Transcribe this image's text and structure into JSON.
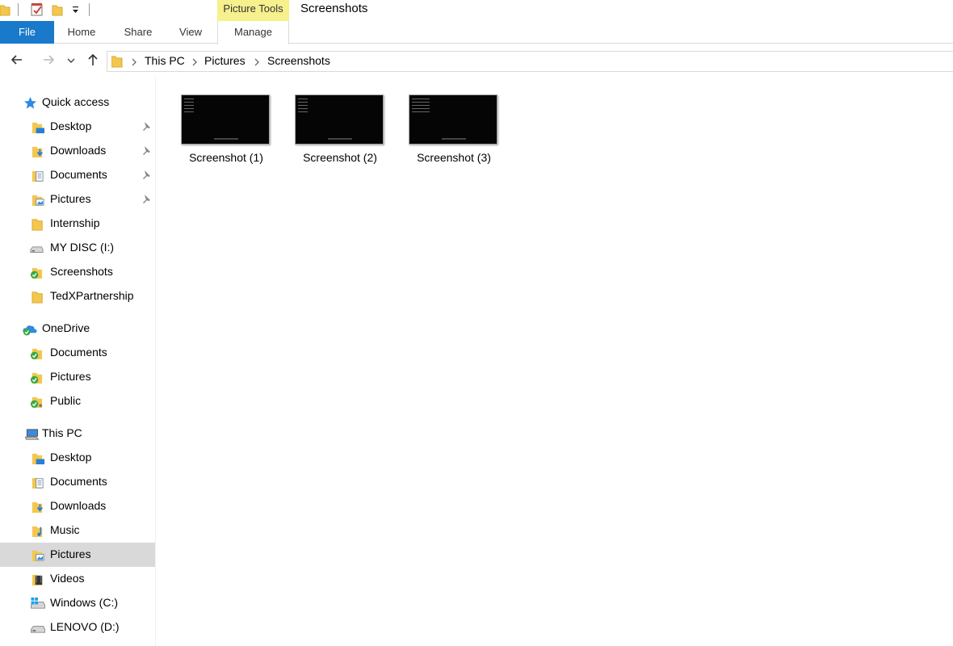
{
  "titlebar": {
    "context_tab_group": "Picture Tools",
    "window_title": "Screenshots"
  },
  "ribbon": {
    "tabs": {
      "file": "File",
      "home": "Home",
      "share": "Share",
      "view": "View",
      "manage": "Manage"
    }
  },
  "address": {
    "crumbs": [
      "This PC",
      "Pictures",
      "Screenshots"
    ]
  },
  "sidebar": {
    "quick_access": {
      "label": "Quick access",
      "items": [
        {
          "label": "Desktop",
          "icon": "desktop-folder-icon",
          "pinned": true
        },
        {
          "label": "Downloads",
          "icon": "downloads-folder-icon",
          "pinned": true
        },
        {
          "label": "Documents",
          "icon": "documents-folder-icon",
          "pinned": true
        },
        {
          "label": "Pictures",
          "icon": "pictures-folder-icon",
          "pinned": true
        },
        {
          "label": "Internship",
          "icon": "folder-icon",
          "pinned": false
        },
        {
          "label": "MY DISC (I:)",
          "icon": "drive-icon",
          "pinned": false
        },
        {
          "label": "Screenshots",
          "icon": "synced-folder-icon",
          "pinned": false
        },
        {
          "label": "TedXPartnership",
          "icon": "folder-icon",
          "pinned": false
        }
      ]
    },
    "onedrive": {
      "label": "OneDrive",
      "items": [
        {
          "label": "Documents",
          "icon": "synced-folder-icon"
        },
        {
          "label": "Pictures",
          "icon": "synced-folder-icon"
        },
        {
          "label": "Public",
          "icon": "shared-folder-icon"
        }
      ]
    },
    "this_pc": {
      "label": "This PC",
      "items": [
        {
          "label": "Desktop",
          "icon": "desktop-folder-icon"
        },
        {
          "label": "Documents",
          "icon": "documents-folder-icon"
        },
        {
          "label": "Downloads",
          "icon": "downloads-folder-icon"
        },
        {
          "label": "Music",
          "icon": "music-folder-icon"
        },
        {
          "label": "Pictures",
          "icon": "pictures-folder-icon",
          "selected": true
        },
        {
          "label": "Videos",
          "icon": "videos-folder-icon"
        },
        {
          "label": "Windows (C:)",
          "icon": "windows-drive-icon"
        },
        {
          "label": "LENOVO (D:)",
          "icon": "drive-icon"
        }
      ]
    }
  },
  "files": [
    {
      "name": "Screenshot (1)"
    },
    {
      "name": "Screenshot (2)"
    },
    {
      "name": "Screenshot (3)"
    }
  ],
  "colors": {
    "file_tab": "#1979ca",
    "context_tab": "#f6f08d",
    "selected_nav": "#d9d9d9",
    "folder": "#f3c74f"
  }
}
